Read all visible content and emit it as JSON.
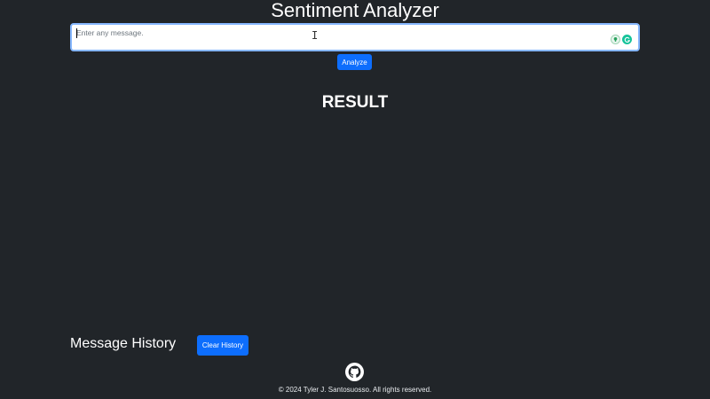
{
  "header": {
    "title": "Sentiment Analyzer"
  },
  "message_input": {
    "placeholder": "Enter any message.",
    "value": ""
  },
  "analyze_button": {
    "label": "Analyze"
  },
  "result": {
    "heading": "RESULT"
  },
  "history": {
    "heading": "Message History",
    "clear_label": "Clear History"
  },
  "footer": {
    "text": "© 2024 Tyler J. Santosuosso. All rights reserved.",
    "icon": "github-icon"
  },
  "colors": {
    "background": "#212529",
    "primary": "#0d6efd",
    "input_border": "#86b7fe",
    "grammarly": "#15c39a"
  }
}
